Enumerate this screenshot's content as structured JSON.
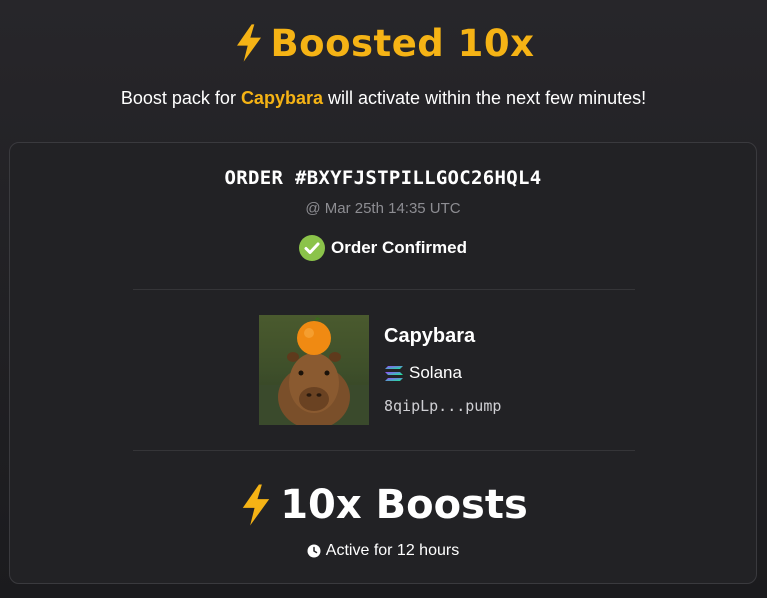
{
  "header": {
    "title": "Boosted 10x",
    "subtitle_prefix": "Boost pack for ",
    "subtitle_token": "Capybara",
    "subtitle_suffix": " will activate within the next few minutes!"
  },
  "order": {
    "id": "ORDER #BXYFJSTPILLGOC26HQL4",
    "timestamp": "@ Mar 25th 14:35 UTC",
    "status": "Order Confirmed"
  },
  "token": {
    "name": "Capybara",
    "chain": "Solana",
    "address": "8qipLp...pump",
    "image_icon": "capybara-with-orange-image"
  },
  "boost": {
    "amount_label": "10x Boosts",
    "duration_label": "Active for 12 hours"
  },
  "colors": {
    "accent": "#f5b315",
    "success": "#8bc34a",
    "background": "#1f1f22",
    "card": "#222225"
  }
}
